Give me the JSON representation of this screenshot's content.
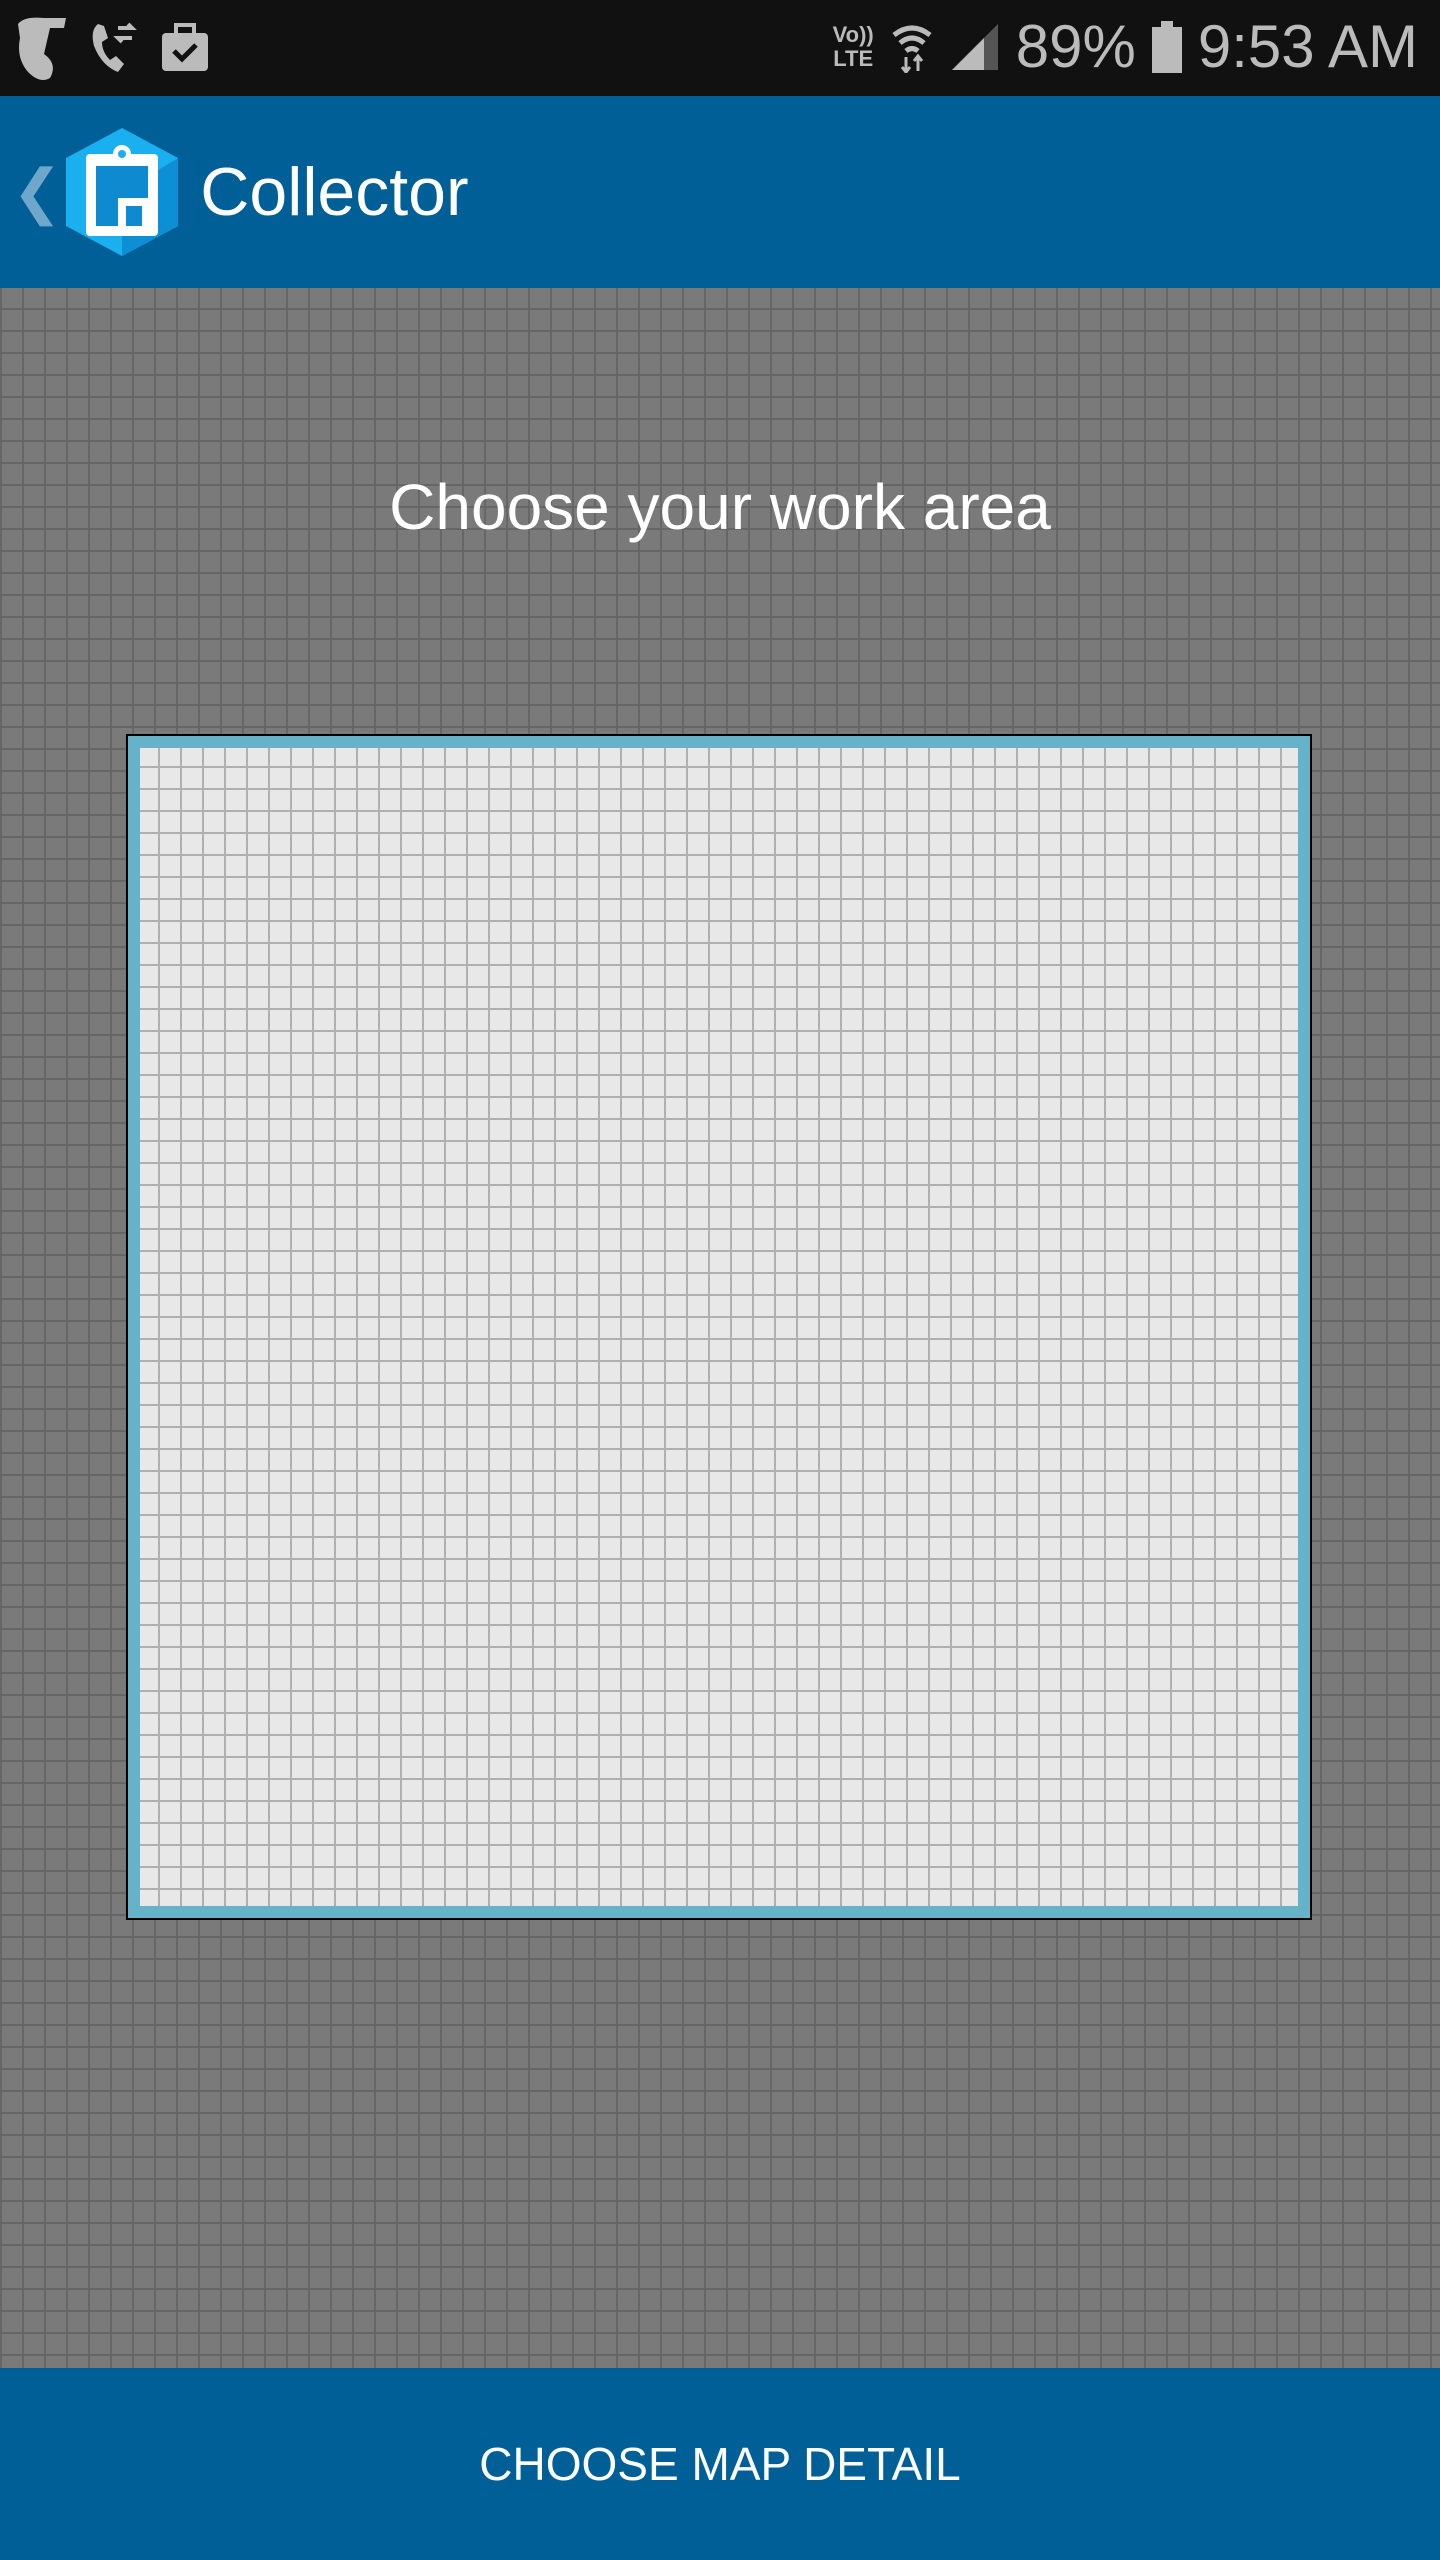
{
  "status_bar": {
    "icons_left": [
      "telstra-icon",
      "call-forward-icon",
      "briefcase-check-icon"
    ],
    "volte_top": "Vo))",
    "volte_bottom": "LTE",
    "battery": "89%",
    "time": "9:53 AM"
  },
  "header": {
    "title": "Collector",
    "back_icon": "chevron-left-icon"
  },
  "main": {
    "heading": "Choose your work area"
  },
  "footer": {
    "button_label": "CHOOSE MAP DETAIL"
  },
  "colors": {
    "brand": "#005f96",
    "area_border": "#66b2c9",
    "status_bar": "#111111"
  }
}
